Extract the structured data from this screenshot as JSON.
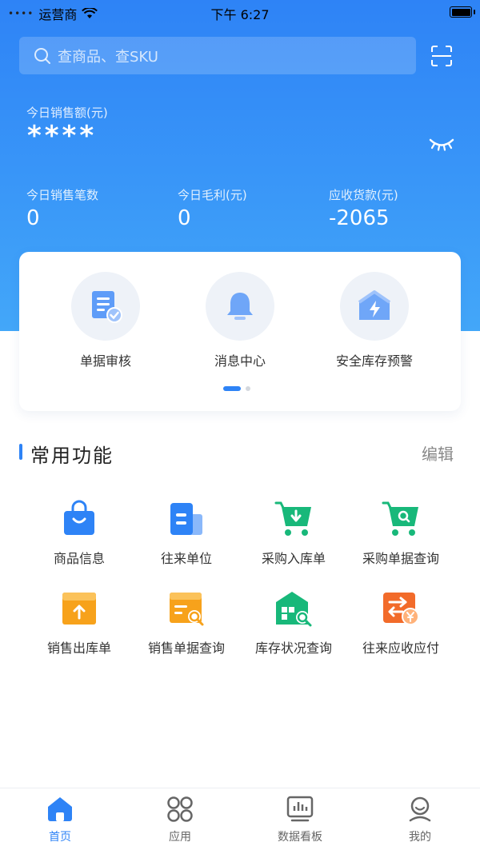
{
  "status_bar": {
    "carrier": "运营商",
    "time": "下午 6:27"
  },
  "search": {
    "placeholder": "查商品、查SKU"
  },
  "sales": {
    "today_amount_label": "今日销售额(元)",
    "today_amount_masked": "****",
    "stats": [
      {
        "label": "今日销售笔数",
        "value": "0"
      },
      {
        "label": "今日毛利(元)",
        "value": "0"
      },
      {
        "label": "应收货款(元)",
        "value": "-2065"
      }
    ]
  },
  "quick_actions": [
    {
      "label": "单据审核",
      "icon": "document-check-icon"
    },
    {
      "label": "消息中心",
      "icon": "bell-icon"
    },
    {
      "label": "安全库存预警",
      "icon": "warehouse-alert-icon"
    }
  ],
  "carousel": {
    "pages": 2,
    "active_page": 1
  },
  "common_functions": {
    "title": "常用功能",
    "edit_label": "编辑",
    "items": [
      {
        "label": "商品信息",
        "icon": "shopping-bag-icon",
        "color": "#2e83f6"
      },
      {
        "label": "往来单位",
        "icon": "building-icon",
        "color": "#2e83f6"
      },
      {
        "label": "采购入库单",
        "icon": "cart-inbound-icon",
        "color": "#18b87a"
      },
      {
        "label": "采购单据查询",
        "icon": "cart-search-icon",
        "color": "#18b87a"
      },
      {
        "label": "销售出库单",
        "icon": "box-outbound-icon",
        "color": "#f7a21b"
      },
      {
        "label": "销售单据查询",
        "icon": "box-search-icon",
        "color": "#f7a21b"
      },
      {
        "label": "库存状况查询",
        "icon": "warehouse-search-icon",
        "color": "#18b87a"
      },
      {
        "label": "往来应收应付",
        "icon": "exchange-money-icon",
        "color": "#f26b2a"
      }
    ]
  },
  "tab_bar": {
    "active": "首页",
    "tabs": [
      {
        "label": "首页",
        "icon": "home-icon"
      },
      {
        "label": "应用",
        "icon": "apps-grid-icon"
      },
      {
        "label": "数据看板",
        "icon": "dashboard-chart-icon"
      },
      {
        "label": "我的",
        "icon": "user-profile-icon"
      }
    ]
  },
  "colors": {
    "primary": "#2e83f6",
    "green": "#18b87a",
    "orange": "#f7a21b",
    "red_orange": "#f26b2a"
  }
}
